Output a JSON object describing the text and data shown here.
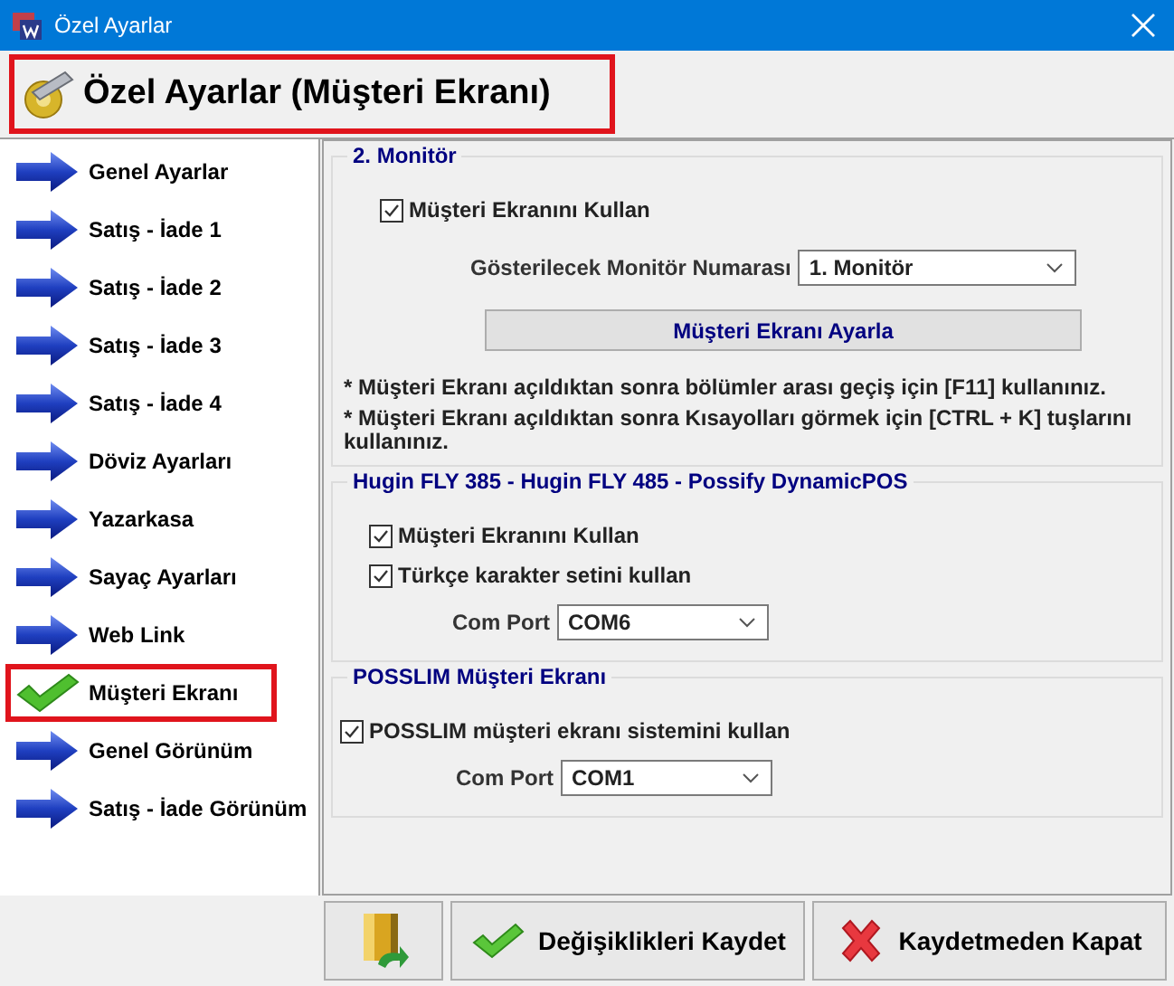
{
  "window": {
    "title": "Özel Ayarlar"
  },
  "header": {
    "title": "Özel Ayarlar (Müşteri Ekranı)"
  },
  "sidebar": {
    "items": [
      {
        "label": "Genel Ayarlar",
        "selected": false
      },
      {
        "label": "Satış - İade 1",
        "selected": false
      },
      {
        "label": "Satış - İade 2",
        "selected": false
      },
      {
        "label": "Satış - İade 3",
        "selected": false
      },
      {
        "label": "Satış - İade 4",
        "selected": false
      },
      {
        "label": "Döviz Ayarları",
        "selected": false
      },
      {
        "label": "Yazarkasa",
        "selected": false
      },
      {
        "label": "Sayaç Ayarları",
        "selected": false
      },
      {
        "label": "Web Link",
        "selected": false
      },
      {
        "label": "Müşteri Ekranı",
        "selected": true
      },
      {
        "label": "Genel Görünüm",
        "selected": false
      },
      {
        "label": "Satış - İade Görünüm",
        "selected": false
      }
    ]
  },
  "groups": [
    {
      "title": "2. Monitör",
      "controls": [
        {
          "kind": "checkbox",
          "label": "Müşteri Ekranını Kullan",
          "checked": true
        },
        {
          "kind": "select",
          "label": "Gösterilecek Monitör Numarası",
          "value": "1. Monitör"
        },
        {
          "kind": "button",
          "label": "Müşteri Ekranı Ayarla"
        },
        {
          "kind": "note",
          "text": "* Müşteri Ekranı  açıldıktan sonra bölümler arası geçiş için [F11] kullanınız."
        },
        {
          "kind": "note",
          "text": "* Müşteri Ekranı  açıldıktan sonra Kısayolları görmek için [CTRL + K] tuşlarını kullanınız."
        }
      ]
    },
    {
      "title": "Hugin FLY 385 - Hugin FLY 485 - Possify DynamicPOS",
      "controls": [
        {
          "kind": "checkbox",
          "label": "Müşteri Ekranını Kullan",
          "checked": true
        },
        {
          "kind": "checkbox",
          "label": "Türkçe karakter setini kullan",
          "checked": true
        },
        {
          "kind": "select",
          "label": "Com Port",
          "value": "COM6"
        }
      ]
    },
    {
      "title": "POSSLIM Müşteri Ekranı",
      "controls": [
        {
          "kind": "checkbox",
          "label": "POSSLIM müşteri ekranı sistemini kullan",
          "checked": true
        },
        {
          "kind": "select",
          "label": "Com Port",
          "value": "COM1"
        }
      ]
    }
  ],
  "footer": {
    "buttons": [
      {
        "kind": "exit"
      },
      {
        "kind": "save",
        "label": "Değişiklikleri Kaydet"
      },
      {
        "kind": "cancel",
        "label": "Kaydetmeden Kapat"
      }
    ]
  }
}
